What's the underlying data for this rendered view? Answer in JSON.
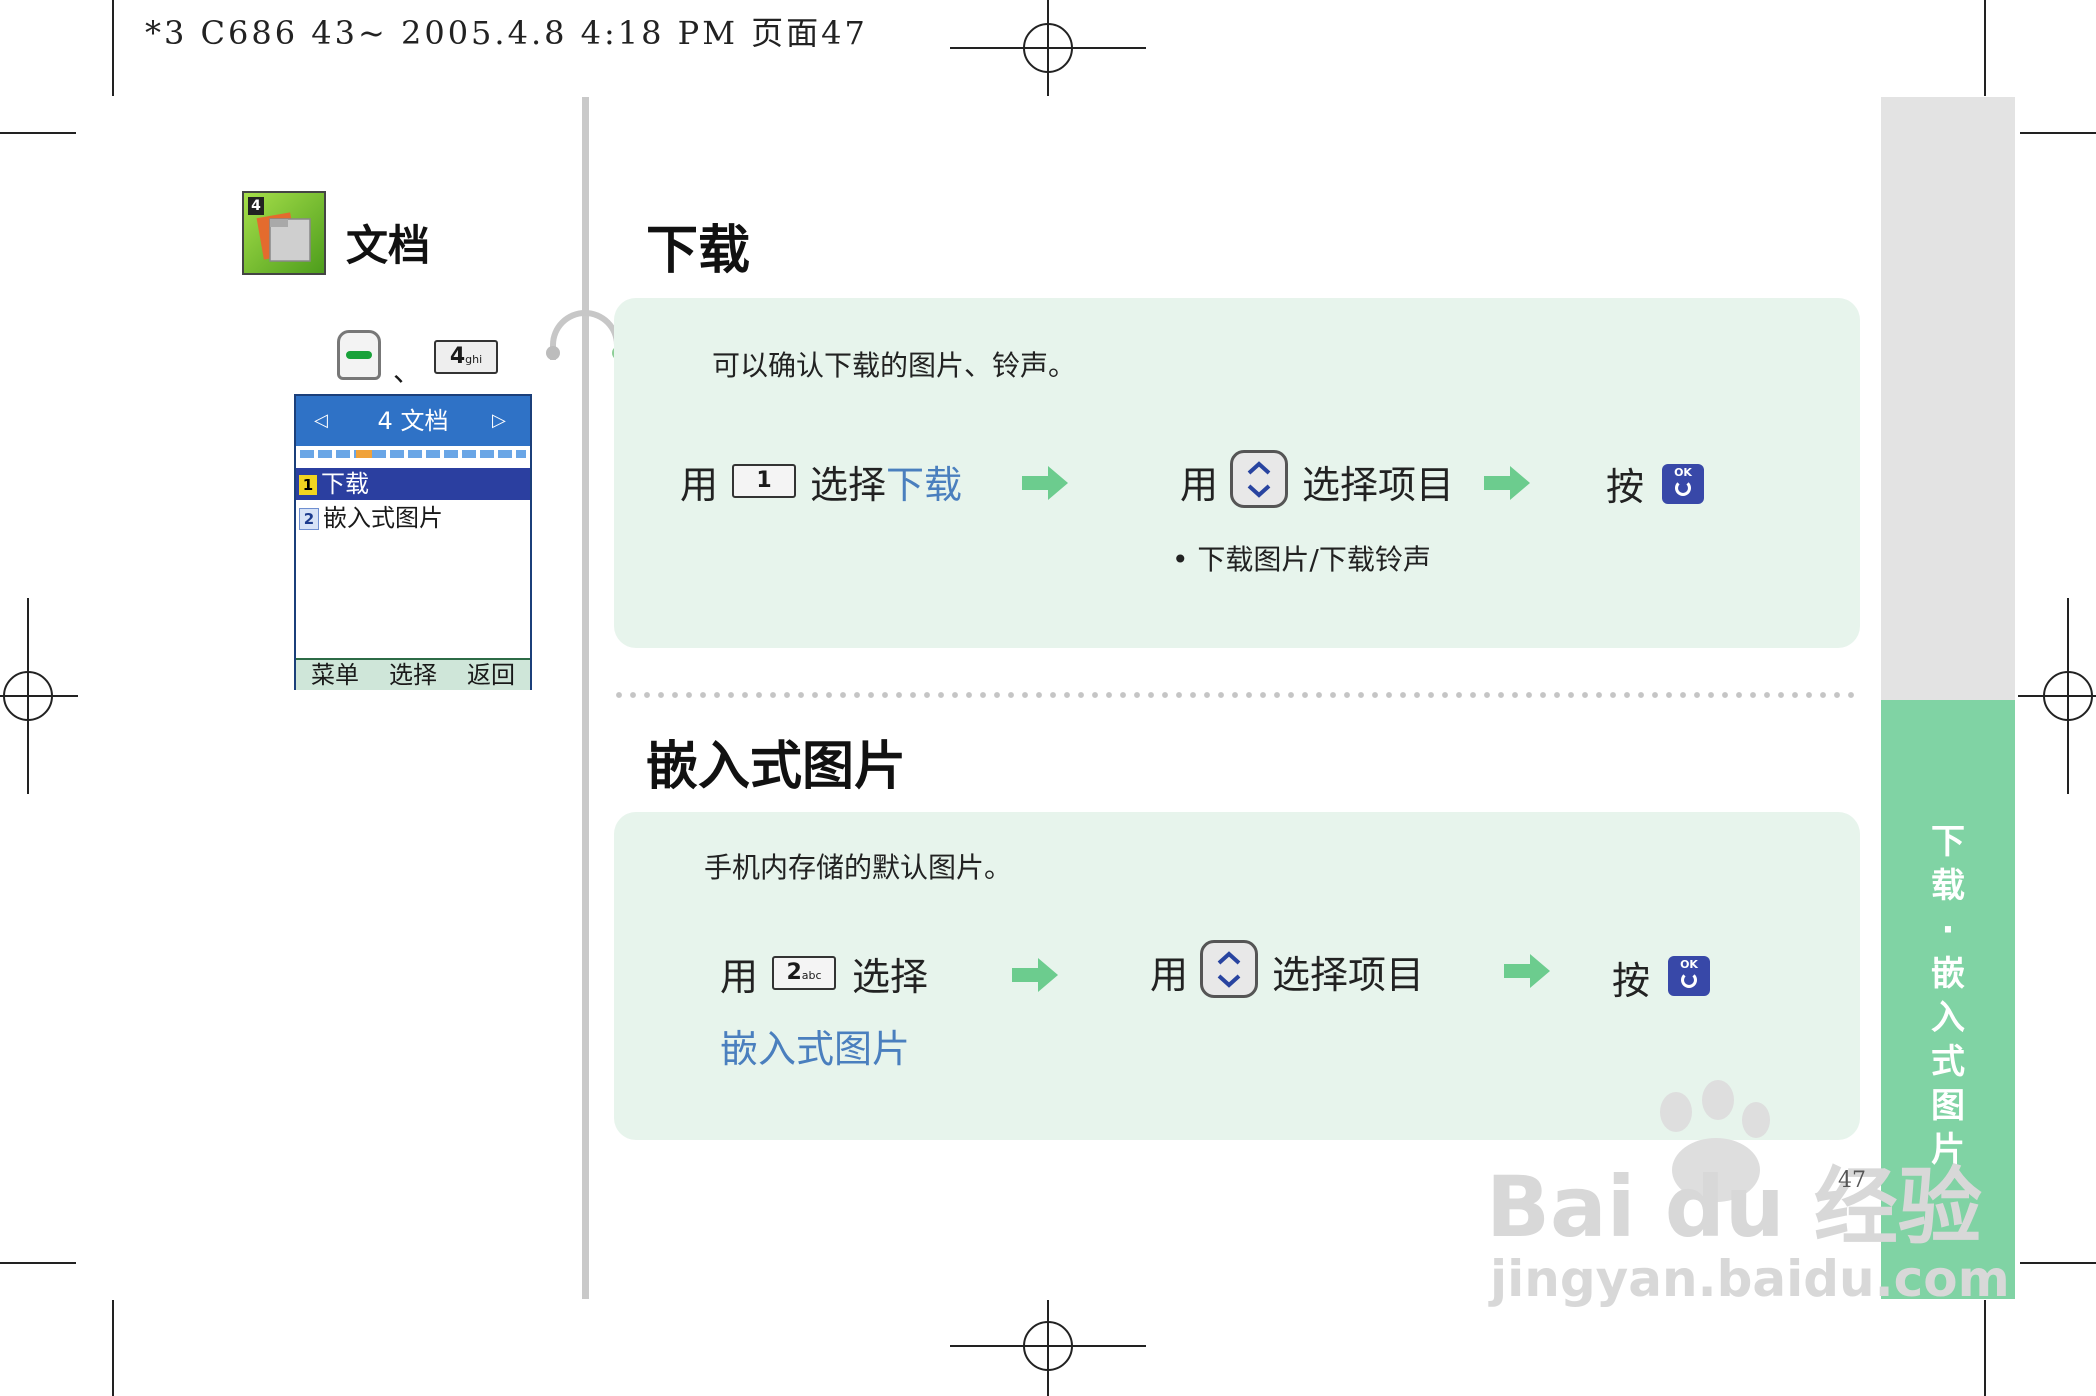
{
  "header": {
    "print_info": "*3 C686 43~ 2005.4.8 4:18 PM 页面47"
  },
  "sidebar": {
    "section_title": "文档",
    "icon_badge": "4",
    "separator": "、",
    "key_label": "4",
    "key_sub": "ghi",
    "phone": {
      "title": "4 文档",
      "items": [
        {
          "num": "1",
          "label": "下载"
        },
        {
          "num": "2",
          "label": "嵌入式图片"
        }
      ],
      "softkeys": [
        "菜单",
        "选择",
        "返回"
      ]
    }
  },
  "download": {
    "title": "下载",
    "description": "可以确认下载的图片、铃声。",
    "step1": {
      "prefix": "用",
      "key": "1",
      "action": "选择",
      "target": "下载"
    },
    "step2": {
      "prefix": "用",
      "action": "选择项目"
    },
    "step3": {
      "prefix": "按",
      "key": "OK"
    },
    "note": "• 下载图片/下载铃声"
  },
  "embedded": {
    "title": "嵌入式图片",
    "description": "手机内存储的默认图片。",
    "step1": {
      "prefix": "用",
      "key": "2",
      "key_sub": "abc",
      "action": "选择",
      "target": "嵌入式图片"
    },
    "step2": {
      "prefix": "用",
      "action": "选择项目"
    },
    "step3": {
      "prefix": "按",
      "key": "OK"
    }
  },
  "side_tab": {
    "chars": [
      "下",
      "载",
      "·",
      "嵌",
      "入",
      "式",
      "图",
      "片"
    ]
  },
  "footer": {
    "page_number": "47"
  },
  "watermark": {
    "brand": "Bai du 经验",
    "url": "jingyan.baidu.com"
  },
  "colors": {
    "accent_green": "#80d3a4",
    "panel_bg": "#e7f4ec",
    "link_blue": "#4a7fbe",
    "phone_header": "#2f72c6",
    "phone_selection": "#2b3fa0"
  }
}
